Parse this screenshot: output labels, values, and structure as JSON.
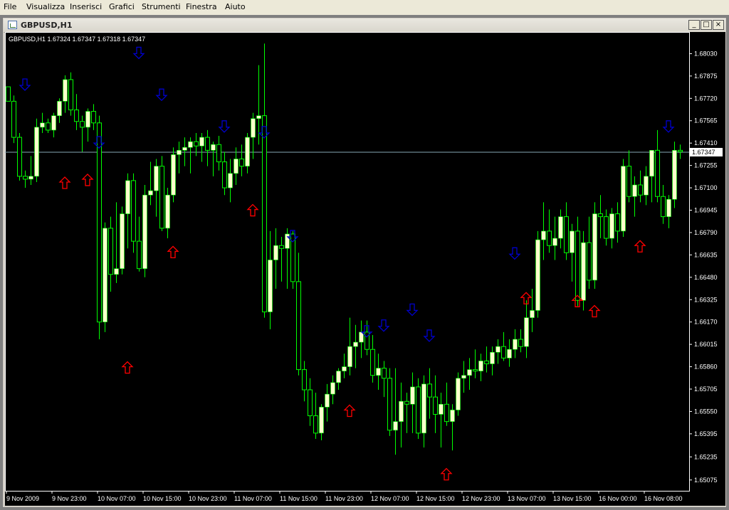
{
  "menu": [
    "File",
    "Visualizza",
    "Inserisci",
    "Grafici",
    "Strumenti",
    "Finestra",
    "Aiuto"
  ],
  "window": {
    "title": "GBPUSD,H1",
    "min_label": "_",
    "max_label": "□",
    "close_label": "×"
  },
  "chart_info": "GBPUSD,H1  1.67324 1.67347 1.67318 1.67347",
  "colors": {
    "background": "#000000",
    "bull": "#ffffcc",
    "wick": "#00ff00",
    "up_arrow": "#ff0000",
    "down_arrow": "#0000cc",
    "bid_line": "#86a7b3",
    "axis_text": "#ffffff"
  },
  "chart_data": {
    "type": "candlestick",
    "symbol": "GBPUSD",
    "timeframe": "H1",
    "ylim": [
      1.65,
      1.6818
    ],
    "y_ticks": [
      "1.68030",
      "1.67875",
      "1.67720",
      "1.67565",
      "1.67410",
      "1.67255",
      "1.67100",
      "1.66945",
      "1.66790",
      "1.66635",
      "1.66480",
      "1.66325",
      "1.66170",
      "1.66015",
      "1.65860",
      "1.65705",
      "1.65550",
      "1.65395",
      "1.65235",
      "1.65075"
    ],
    "x_ticks": [
      "9 Nov 2009",
      "9 Nov 23:00",
      "10 Nov 07:00",
      "10 Nov 15:00",
      "10 Nov 23:00",
      "11 Nov 07:00",
      "11 Nov 15:00",
      "11 Nov 23:00",
      "12 Nov 07:00",
      "12 Nov 15:00",
      "12 Nov 23:00",
      "13 Nov 07:00",
      "13 Nov 15:00",
      "16 Nov 00:00",
      "16 Nov 08:00"
    ],
    "current_price": "1.67347",
    "arrows_up": [
      [
        10,
        1.6712
      ],
      [
        14,
        1.6714
      ],
      [
        21,
        1.6584
      ],
      [
        29,
        1.6664
      ],
      [
        43,
        1.6693
      ],
      [
        60,
        1.6554
      ],
      [
        77,
        1.651
      ],
      [
        91,
        1.6632
      ],
      [
        100,
        1.663
      ],
      [
        103,
        1.6623
      ],
      [
        111,
        1.6668
      ]
    ],
    "arrows_down": [
      [
        3,
        1.6783
      ],
      [
        23,
        1.6805
      ],
      [
        27,
        1.6776
      ],
      [
        16,
        1.6743
      ],
      [
        38,
        1.6754
      ],
      [
        45,
        1.675
      ],
      [
        50,
        1.6678
      ],
      [
        63,
        1.6612
      ],
      [
        66,
        1.6616
      ],
      [
        71,
        1.6627
      ],
      [
        74,
        1.6609
      ],
      [
        89,
        1.6666
      ],
      [
        116,
        1.6754
      ]
    ],
    "candles": [
      [
        1.678,
        1.678,
        1.6777,
        1.677
      ],
      [
        1.677,
        1.6774,
        1.6741,
        1.6745
      ],
      [
        1.6745,
        1.6748,
        1.6715,
        1.6718
      ],
      [
        1.6718,
        1.6722,
        1.671,
        1.6716
      ],
      [
        1.6716,
        1.6732,
        1.6712,
        1.6718
      ],
      [
        1.6718,
        1.6758,
        1.6714,
        1.6752
      ],
      [
        1.6752,
        1.6762,
        1.6748,
        1.6755
      ],
      [
        1.6755,
        1.6758,
        1.6748,
        1.675
      ],
      [
        1.675,
        1.6762,
        1.6745,
        1.676
      ],
      [
        1.676,
        1.6772,
        1.6755,
        1.677
      ],
      [
        1.677,
        1.6788,
        1.6762,
        1.6785
      ],
      [
        1.6785,
        1.679,
        1.676,
        1.6764
      ],
      [
        1.6764,
        1.6775,
        1.675,
        1.6756
      ],
      [
        1.6756,
        1.676,
        1.6735,
        1.6752
      ],
      [
        1.6752,
        1.6765,
        1.6742,
        1.6763
      ],
      [
        1.6763,
        1.6768,
        1.675,
        1.6755
      ],
      [
        1.6755,
        1.676,
        1.6605,
        1.6617
      ],
      [
        1.6617,
        1.6686,
        1.661,
        1.6682
      ],
      [
        1.6682,
        1.669,
        1.6638,
        1.665
      ],
      [
        1.665,
        1.67,
        1.6644,
        1.6654
      ],
      [
        1.6654,
        1.6697,
        1.665,
        1.6692
      ],
      [
        1.6692,
        1.672,
        1.6668,
        1.6715
      ],
      [
        1.6715,
        1.672,
        1.6665,
        1.6673
      ],
      [
        1.6673,
        1.669,
        1.6652,
        1.6654
      ],
      [
        1.6654,
        1.6712,
        1.6648,
        1.6705
      ],
      [
        1.6705,
        1.6728,
        1.6698,
        1.6708
      ],
      [
        1.6708,
        1.673,
        1.669,
        1.6725
      ],
      [
        1.6725,
        1.6732,
        1.668,
        1.6682
      ],
      [
        1.6682,
        1.671,
        1.6675,
        1.6705
      ],
      [
        1.6705,
        1.6738,
        1.67,
        1.6733
      ],
      [
        1.6733,
        1.6742,
        1.672,
        1.6736
      ],
      [
        1.6736,
        1.6745,
        1.6725,
        1.6738
      ],
      [
        1.6738,
        1.6745,
        1.672,
        1.6742
      ],
      [
        1.6742,
        1.6748,
        1.6732,
        1.6739
      ],
      [
        1.6739,
        1.6748,
        1.6728,
        1.6745
      ],
      [
        1.6745,
        1.675,
        1.6725,
        1.6736
      ],
      [
        1.6736,
        1.6742,
        1.6718,
        1.674
      ],
      [
        1.674,
        1.6746,
        1.6722,
        1.6728
      ],
      [
        1.6728,
        1.6735,
        1.6705,
        1.671
      ],
      [
        1.671,
        1.673,
        1.67,
        1.672
      ],
      [
        1.672,
        1.6738,
        1.6712,
        1.673
      ],
      [
        1.673,
        1.674,
        1.6718,
        1.6725
      ],
      [
        1.6725,
        1.6748,
        1.672,
        1.6745
      ],
      [
        1.6745,
        1.6762,
        1.673,
        1.6758
      ],
      [
        1.6758,
        1.6795,
        1.674,
        1.676
      ],
      [
        1.676,
        1.681,
        1.662,
        1.6624
      ],
      [
        1.6624,
        1.668,
        1.6612,
        1.666
      ],
      [
        1.666,
        1.6682,
        1.664,
        1.667
      ],
      [
        1.667,
        1.6676,
        1.6645,
        1.6668
      ],
      [
        1.6668,
        1.6682,
        1.664,
        1.6678
      ],
      [
        1.6678,
        1.668,
        1.664,
        1.6645
      ],
      [
        1.6645,
        1.6665,
        1.658,
        1.6584
      ],
      [
        1.6584,
        1.659,
        1.6562,
        1.657
      ],
      [
        1.657,
        1.6578,
        1.6545,
        1.6552
      ],
      [
        1.6552,
        1.6568,
        1.6536,
        1.654
      ],
      [
        1.654,
        1.656,
        1.6535,
        1.6558
      ],
      [
        1.6558,
        1.6574,
        1.6548,
        1.6567
      ],
      [
        1.6567,
        1.658,
        1.656,
        1.6575
      ],
      [
        1.6575,
        1.6585,
        1.657,
        1.6583
      ],
      [
        1.6583,
        1.6595,
        1.6578,
        1.6586
      ],
      [
        1.6586,
        1.662,
        1.658,
        1.66
      ],
      [
        1.66,
        1.6615,
        1.6585,
        1.6603
      ],
      [
        1.6603,
        1.6618,
        1.6592,
        1.661
      ],
      [
        1.661,
        1.6618,
        1.6594,
        1.6598
      ],
      [
        1.6598,
        1.6608,
        1.6575,
        1.658
      ],
      [
        1.658,
        1.6595,
        1.657,
        1.6585
      ],
      [
        1.6585,
        1.659,
        1.6565,
        1.6578
      ],
      [
        1.6578,
        1.6585,
        1.6538,
        1.6542
      ],
      [
        1.6542,
        1.6585,
        1.6525,
        1.6548
      ],
      [
        1.6548,
        1.6575,
        1.653,
        1.6562
      ],
      [
        1.6562,
        1.6568,
        1.654,
        1.656
      ],
      [
        1.656,
        1.6582,
        1.654,
        1.6572
      ],
      [
        1.6572,
        1.6578,
        1.6536,
        1.654
      ],
      [
        1.654,
        1.658,
        1.653,
        1.6574
      ],
      [
        1.6574,
        1.6585,
        1.655,
        1.6565
      ],
      [
        1.6565,
        1.658,
        1.654,
        1.6553
      ],
      [
        1.6553,
        1.6568,
        1.653,
        1.656
      ],
      [
        1.656,
        1.6575,
        1.6545,
        1.6548
      ],
      [
        1.6548,
        1.656,
        1.6528,
        1.6556
      ],
      [
        1.6556,
        1.6582,
        1.6552,
        1.6578
      ],
      [
        1.6578,
        1.659,
        1.6568,
        1.658
      ],
      [
        1.658,
        1.6592,
        1.657,
        1.6584
      ],
      [
        1.6584,
        1.6598,
        1.6578,
        1.6583
      ],
      [
        1.6583,
        1.6595,
        1.6576,
        1.659
      ],
      [
        1.659,
        1.66,
        1.6582,
        1.6588
      ],
      [
        1.6588,
        1.66,
        1.658,
        1.6596
      ],
      [
        1.6596,
        1.6605,
        1.6588,
        1.66
      ],
      [
        1.66,
        1.661,
        1.659,
        1.6592
      ],
      [
        1.6592,
        1.6605,
        1.6586,
        1.6598
      ],
      [
        1.6598,
        1.6612,
        1.6592,
        1.6605
      ],
      [
        1.6605,
        1.6612,
        1.6596,
        1.66
      ],
      [
        1.66,
        1.6632,
        1.6592,
        1.662
      ],
      [
        1.662,
        1.664,
        1.661,
        1.6625
      ],
      [
        1.6625,
        1.668,
        1.662,
        1.6674
      ],
      [
        1.6674,
        1.67,
        1.666,
        1.668
      ],
      [
        1.668,
        1.6695,
        1.6665,
        1.667
      ],
      [
        1.667,
        1.669,
        1.666,
        1.6675
      ],
      [
        1.6675,
        1.6695,
        1.6668,
        1.669
      ],
      [
        1.669,
        1.67,
        1.666,
        1.6665
      ],
      [
        1.6665,
        1.6685,
        1.6645,
        1.668
      ],
      [
        1.668,
        1.669,
        1.6628,
        1.6632
      ],
      [
        1.6632,
        1.668,
        1.6625,
        1.6672
      ],
      [
        1.6672,
        1.669,
        1.664,
        1.6646
      ],
      [
        1.6646,
        1.67,
        1.664,
        1.6692
      ],
      [
        1.6692,
        1.6705,
        1.6675,
        1.669
      ],
      [
        1.669,
        1.6695,
        1.667,
        1.6675
      ],
      [
        1.6675,
        1.6696,
        1.6668,
        1.6692
      ],
      [
        1.6692,
        1.67,
        1.6672,
        1.668
      ],
      [
        1.668,
        1.673,
        1.6676,
        1.6725
      ],
      [
        1.6725,
        1.6736,
        1.67,
        1.6704
      ],
      [
        1.6704,
        1.6718,
        1.669,
        1.6712
      ],
      [
        1.6712,
        1.6722,
        1.67,
        1.6705
      ],
      [
        1.6705,
        1.6725,
        1.6698,
        1.6718
      ],
      [
        1.6718,
        1.6732,
        1.67,
        1.6736
      ],
      [
        1.6736,
        1.675,
        1.67,
        1.6704
      ],
      [
        1.6704,
        1.6712,
        1.6685,
        1.669
      ],
      [
        1.669,
        1.6705,
        1.6682,
        1.6702
      ],
      [
        1.6702,
        1.6742,
        1.6696,
        1.6736
      ],
      [
        1.6736,
        1.674,
        1.673,
        1.6735
      ]
    ]
  }
}
